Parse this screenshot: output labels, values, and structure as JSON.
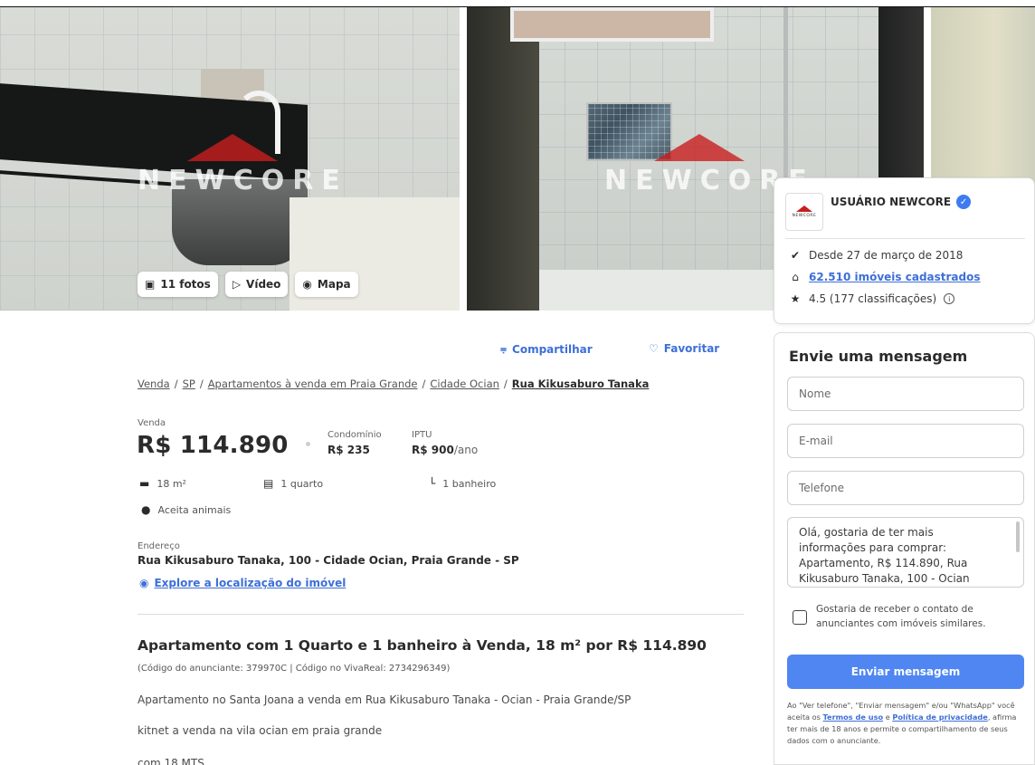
{
  "gallery": {
    "watermark": "NEWCORE",
    "photos_label": "11 fotos",
    "video_label": "Vídeo",
    "map_label": "Mapa"
  },
  "actions": {
    "share_label": "Compartilhar",
    "favorite_label": "Favoritar"
  },
  "breadcrumb": {
    "items": [
      "Venda",
      "SP",
      "Apartamentos à venda em Praia Grande",
      "Cidade Ocian"
    ],
    "separator": "/",
    "current": "Rua Kikusaburo Tanaka"
  },
  "pricing": {
    "label": "Venda",
    "price": "R$ 114.890",
    "condo_label": "Condomínio",
    "condo_value": "R$ 235",
    "iptu_label": "IPTU",
    "iptu_value": "R$ 900",
    "iptu_suffix": "/ano"
  },
  "features": {
    "area": "18 m²",
    "rooms": "1 quarto",
    "bathrooms": "1 banheiro",
    "pets": "Aceita animais"
  },
  "address": {
    "label": "Endereço",
    "value": "Rua Kikusaburo Tanaka, 100 - Cidade Ocian, Praia Grande - SP",
    "explore_label": "Explore a localização do imóvel"
  },
  "listing": {
    "headline": "Apartamento com 1 Quarto e 1 banheiro à Venda, 18 m² por R$ 114.890",
    "codes": "(Código do anunciante: 379970C | Código no VivaReal: 2734296349)",
    "description": [
      "Apartamento no Santa Joana a venda em Rua Kikusaburo Tanaka - Ocian - Praia Grande/SP",
      "kitnet a venda na vila ocian em praia grande",
      "com 18 MTS"
    ]
  },
  "seller": {
    "logo_text": "NEWCORE",
    "name": "USUÁRIO NEWCORE",
    "since": "Desde 27 de março de 2018",
    "listings": "62.510 imóveis cadastrados",
    "rating": "4.5 (177 classificações)"
  },
  "contact": {
    "title": "Envie uma mensagem",
    "name_placeholder": "Nome",
    "email_placeholder": "E-mail",
    "phone_placeholder": "Telefone",
    "message": "Olá, gostaria de ter mais informações para comprar: Apartamento, R$ 114.890, Rua Kikusaburo Tanaka, 100 - Ocian",
    "checkbox_label": "Gostaria de receber o contato de anunciantes com imóveis similares.",
    "send_label": "Enviar mensagem",
    "legal_prefix": "Ao \"Ver telefone\", \"Enviar mensagem\" e/ou \"WhatsApp\" você aceita os ",
    "terms_label": "Termos de uso",
    "legal_and": " e ",
    "privacy_label": "Política de privacidade",
    "legal_suffix": ", afirma ter mais de 18 anos e permite o compartilhamento de seus dados com o anunciante."
  },
  "colors": {
    "accent": "#3d6fd8",
    "button": "#4f86f2",
    "verified": "#3d7cf0",
    "brand_red": "#c81e1e"
  },
  "icons": {
    "photos": "camera-icon",
    "video": "video-icon",
    "map": "location-pin-icon",
    "share": "share-icon",
    "favorite": "heart-icon",
    "area": "ruler-icon",
    "rooms": "bed-icon",
    "bathrooms": "shower-icon",
    "pets": "paw-icon",
    "since": "badge-icon",
    "listings": "house-icon",
    "rating": "star-icon"
  }
}
